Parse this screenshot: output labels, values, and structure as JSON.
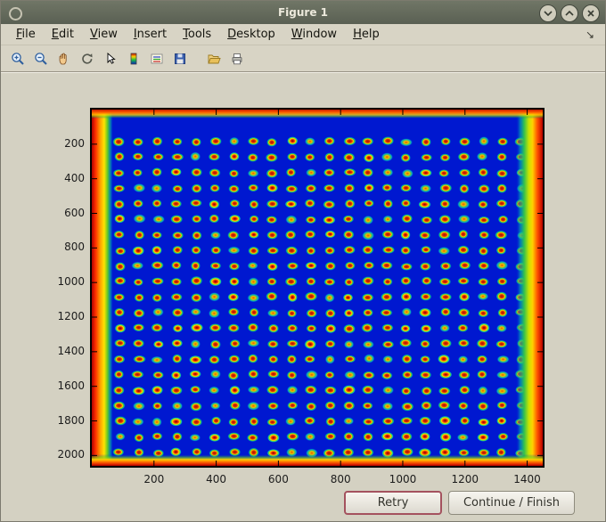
{
  "window": {
    "title": "Figure 1",
    "controls": [
      "shade-button",
      "maximize-button",
      "close-button"
    ]
  },
  "menu": {
    "items": [
      {
        "label": "File"
      },
      {
        "label": "Edit"
      },
      {
        "label": "View"
      },
      {
        "label": "Insert"
      },
      {
        "label": "Tools"
      },
      {
        "label": "Desktop"
      },
      {
        "label": "Window"
      },
      {
        "label": "Help"
      }
    ],
    "dock_arrow": "↘"
  },
  "toolbar": {
    "buttons": [
      {
        "icon": "zoom-in"
      },
      {
        "icon": "zoom-out"
      },
      {
        "icon": "pan-hand"
      },
      {
        "icon": "rotate-3d"
      },
      {
        "icon": "data-cursor"
      },
      {
        "icon": "colorbar"
      },
      {
        "icon": "insert-legend"
      },
      {
        "icon": "save"
      },
      {
        "icon": "open-folder"
      },
      {
        "icon": "print"
      }
    ]
  },
  "chart_data": {
    "type": "heatmap",
    "title": "",
    "xlabel": "",
    "ylabel": "",
    "x_ticks": [
      200,
      400,
      600,
      800,
      1000,
      1200,
      1400
    ],
    "y_ticks": [
      200,
      400,
      600,
      800,
      1000,
      1200,
      1400,
      1600,
      1800,
      2000
    ],
    "x_range": [
      0,
      1450
    ],
    "y_range": [
      0,
      2060
    ],
    "grid": {
      "rows": 21,
      "cols": 22
    },
    "description": "Microarray slide scan shown with jet colormap: regular grid of spots with red centers and green/cyan rims on a blue background; saturated red/orange bands along all four slide edges"
  },
  "actions": {
    "retry_label": "Retry",
    "continue_label": "Continue / Finish"
  }
}
